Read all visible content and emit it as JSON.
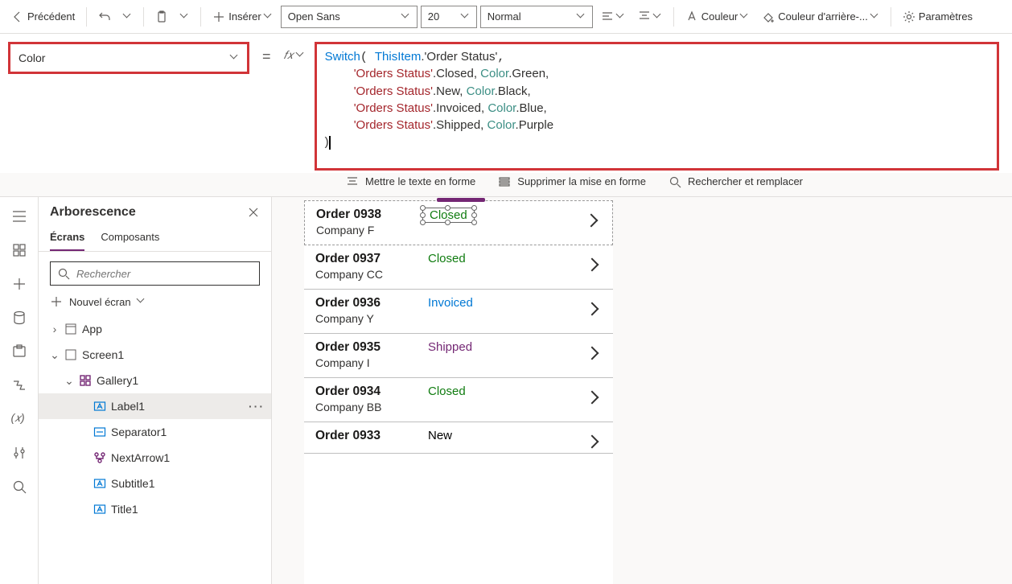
{
  "toolbar": {
    "back": "Précédent",
    "insert": "Insérer",
    "font": "Open Sans",
    "size": "20",
    "weight": "Normal",
    "color_label": "Couleur",
    "bg_label": "Couleur d'arrière-...",
    "settings": "Paramètres"
  },
  "property_dropdown": "Color",
  "fx": "𝑓𝑥",
  "formula_tokens": {
    "switch": "Switch",
    "thisitem": "ThisItem",
    "orderstatus_field": ".'Order Status'",
    "ostat": "'Orders Status'",
    "closed": ".Closed, ",
    "new": ".New, ",
    "invoiced": ".Invoiced, ",
    "shipped": ".Shipped, ",
    "color": "Color",
    "green": ".Green,",
    "black": ".Black,",
    "blue": ".Blue,",
    "purple": ".Purple",
    "close": ")"
  },
  "actions": {
    "format": "Mettre le texte en forme",
    "unformat": "Supprimer la mise en forme",
    "find": "Rechercher et remplacer"
  },
  "tree": {
    "title": "Arborescence",
    "tab_screens": "Écrans",
    "tab_components": "Composants",
    "search_ph": "Rechercher",
    "new_screen": "Nouvel écran",
    "items": [
      {
        "label": "App",
        "level": 1,
        "icon": "app",
        "exp": "›"
      },
      {
        "label": "Screen1",
        "level": 1,
        "icon": "screen",
        "exp": "⌄"
      },
      {
        "label": "Gallery1",
        "level": 2,
        "icon": "gallery",
        "exp": "⌄"
      },
      {
        "label": "Label1",
        "level": 3,
        "icon": "label",
        "sel": true
      },
      {
        "label": "Separator1",
        "level": 3,
        "icon": "sep"
      },
      {
        "label": "NextArrow1",
        "level": 3,
        "icon": "arrow"
      },
      {
        "label": "Subtitle1",
        "level": 3,
        "icon": "label"
      },
      {
        "label": "Title1",
        "level": 3,
        "icon": "label"
      }
    ]
  },
  "gallery": [
    {
      "title": "Order 0938",
      "subtitle": "Company F",
      "status": "Closed",
      "color": "st-green",
      "sel": true
    },
    {
      "title": "Order 0937",
      "subtitle": "Company CC",
      "status": "Closed",
      "color": "st-green"
    },
    {
      "title": "Order 0936",
      "subtitle": "Company Y",
      "status": "Invoiced",
      "color": "st-blue"
    },
    {
      "title": "Order 0935",
      "subtitle": "Company I",
      "status": "Shipped",
      "color": "st-purple"
    },
    {
      "title": "Order 0934",
      "subtitle": "Company BB",
      "status": "Closed",
      "color": "st-green"
    },
    {
      "title": "Order 0933",
      "subtitle": "",
      "status": "New",
      "color": "st-black"
    }
  ]
}
